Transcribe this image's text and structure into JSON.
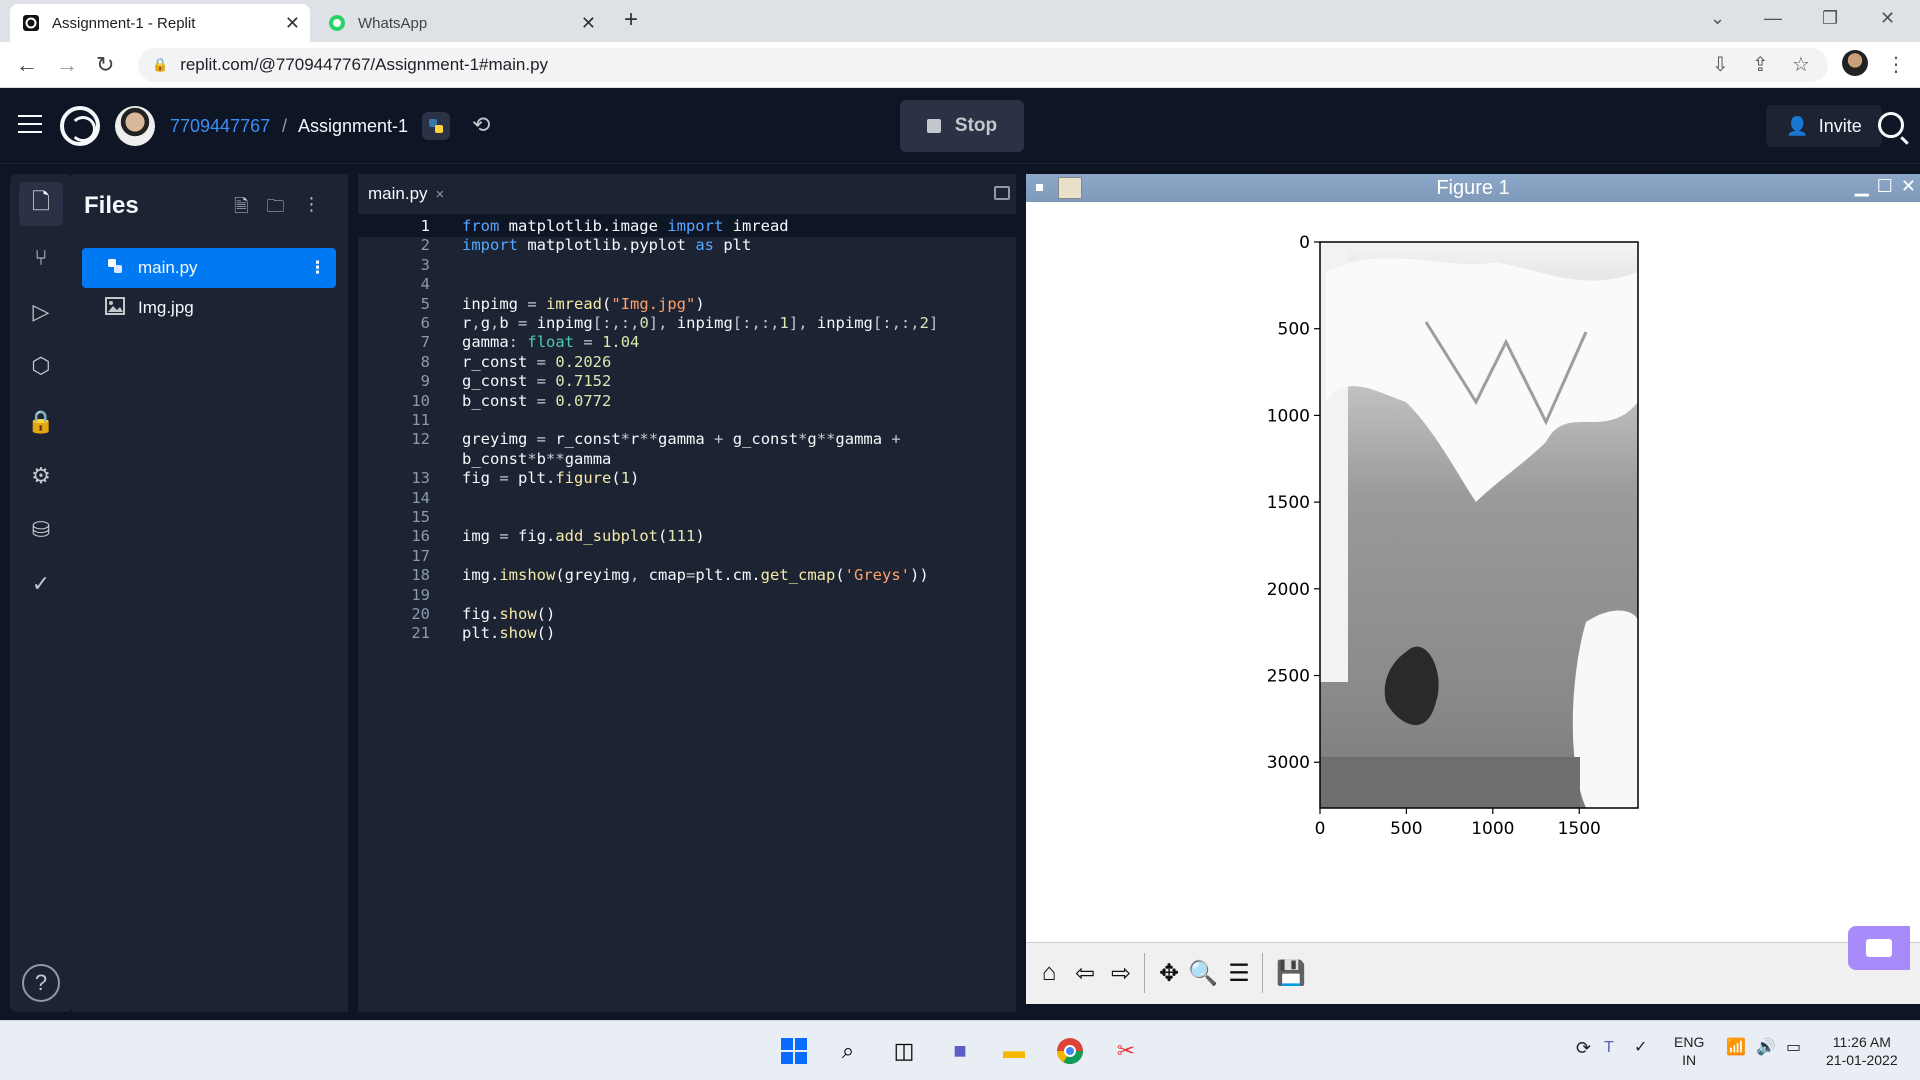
{
  "browser": {
    "tabs": [
      {
        "title": "Assignment-1 - Replit",
        "active": true
      },
      {
        "title": "WhatsApp",
        "active": false
      }
    ],
    "new_tab": "+",
    "url": "replit.com/@7709447767/Assignment-1#main.py"
  },
  "header": {
    "owner": "7709447767",
    "separator": "/",
    "repl_name": "Assignment-1",
    "stop_label": "Stop",
    "invite_label": "Invite"
  },
  "files": {
    "title": "Files",
    "items": [
      {
        "name": "main.py",
        "icon": "python-icon",
        "selected": true
      },
      {
        "name": "Img.jpg",
        "icon": "image-icon",
        "selected": false
      }
    ]
  },
  "editor": {
    "tab_label": "main.py",
    "close": "×",
    "current_line": 1,
    "lines": [
      {
        "n": "1",
        "code": "from matplotlib.image import imread"
      },
      {
        "n": "2",
        "code": "import matplotlib.pyplot as plt"
      },
      {
        "n": "3",
        "code": ""
      },
      {
        "n": "4",
        "code": ""
      },
      {
        "n": "5",
        "code": "inpimg = imread(\"Img.jpg\")"
      },
      {
        "n": "6",
        "code": "r,g,b = inpimg[:,:,0], inpimg[:,:,1], inpimg[:,:,2]"
      },
      {
        "n": "7",
        "code": "gamma: float = 1.04"
      },
      {
        "n": "8",
        "code": "r_const = 0.2026"
      },
      {
        "n": "9",
        "code": "g_const = 0.7152"
      },
      {
        "n": "10",
        "code": "b_const = 0.0772"
      },
      {
        "n": "11",
        "code": ""
      },
      {
        "n": "12",
        "code": "greyimg = r_const*r**gamma + g_const*g**gamma +"
      },
      {
        "n": "",
        "code": "b_const*b**gamma"
      },
      {
        "n": "13",
        "code": "fig = plt.figure(1)"
      },
      {
        "n": "14",
        "code": ""
      },
      {
        "n": "15",
        "code": ""
      },
      {
        "n": "16",
        "code": "img = fig.add_subplot(111)"
      },
      {
        "n": "17",
        "code": ""
      },
      {
        "n": "18",
        "code": "img.imshow(greyimg, cmap=plt.cm.get_cmap('Greys'))"
      },
      {
        "n": "19",
        "code": ""
      },
      {
        "n": "20",
        "code": "fig.show()"
      },
      {
        "n": "21",
        "code": "plt.show()"
      }
    ]
  },
  "figure": {
    "title": "Figure 1",
    "y_ticks": [
      "0",
      "500",
      "1000",
      "1500",
      "2000",
      "2500",
      "3000"
    ],
    "x_ticks": [
      "0",
      "500",
      "1000",
      "1500"
    ]
  },
  "chart_data": {
    "type": "heatmap",
    "title": "",
    "xlabel": "",
    "ylabel": "",
    "x_ticks": [
      0,
      500,
      1000,
      1500
    ],
    "y_ticks": [
      0,
      500,
      1000,
      1500,
      2000,
      2500,
      3000
    ],
    "xlim": [
      0,
      1840
    ],
    "ylim": [
      3264,
      0
    ],
    "colormap": "Greys",
    "description": "greyscale image rendered with imshow"
  },
  "taskbar": {
    "lang_top": "ENG",
    "lang_bottom": "IN",
    "time": "11:26 AM",
    "date": "21-01-2022"
  },
  "colors": {
    "accent": "#0079f2",
    "owner_link": "#3a8ef6",
    "bg": "#0e1525",
    "panel": "#1c2333"
  }
}
